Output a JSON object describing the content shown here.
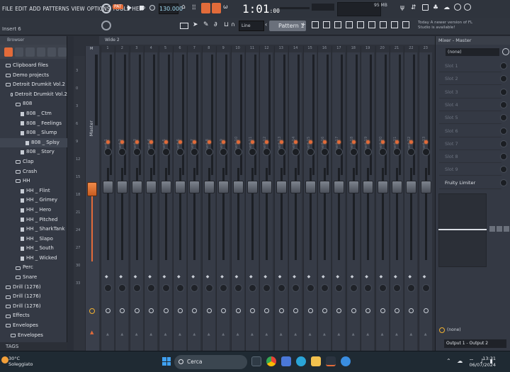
{
  "menu": [
    "FILE",
    "EDIT",
    "ADD",
    "PATTERNS",
    "VIEW",
    "OPTIONS",
    "TOOLS",
    "HELP"
  ],
  "hint": "Insert 6",
  "transport": {
    "pattern_mode": "PAT",
    "tempo": "130.000",
    "time": "1:01",
    "time_sub": ":00"
  },
  "memory": "95 MB",
  "snap": "Line",
  "pattern_name": "Pattern 1",
  "news": "Today  A newer version of FL Studio is available!",
  "browser": {
    "title": "Browser",
    "items": [
      {
        "label": "Clipboard files",
        "indent": 1,
        "kind": "folder"
      },
      {
        "label": "Demo projects",
        "indent": 1,
        "kind": "folder"
      },
      {
        "label": "Detroit Drumkit Vol.2",
        "indent": 1,
        "kind": "folder"
      },
      {
        "label": "Detroit Drumkit Vol.2",
        "indent": 2,
        "kind": "folder"
      },
      {
        "label": "808",
        "indent": 3,
        "kind": "folder"
      },
      {
        "label": "808 _ Ctm",
        "indent": 4,
        "kind": "file"
      },
      {
        "label": "808 _ Feelings",
        "indent": 4,
        "kind": "file"
      },
      {
        "label": "808 _ Slump",
        "indent": 4,
        "kind": "file"
      },
      {
        "label": "808 _ Splsy",
        "indent": 5,
        "kind": "file"
      },
      {
        "label": "808 _ Story",
        "indent": 4,
        "kind": "file"
      },
      {
        "label": "Clap",
        "indent": 3,
        "kind": "folder"
      },
      {
        "label": "Crash",
        "indent": 3,
        "kind": "folder"
      },
      {
        "label": "HH",
        "indent": 3,
        "kind": "folder"
      },
      {
        "label": "HH _ Flint",
        "indent": 4,
        "kind": "file"
      },
      {
        "label": "HH _ Grimey",
        "indent": 4,
        "kind": "file"
      },
      {
        "label": "HH _ Hero",
        "indent": 4,
        "kind": "file"
      },
      {
        "label": "HH _ Pitched",
        "indent": 4,
        "kind": "file"
      },
      {
        "label": "HH _ SharkTank",
        "indent": 4,
        "kind": "file"
      },
      {
        "label": "HH _ Slapo",
        "indent": 4,
        "kind": "file"
      },
      {
        "label": "HH _ South",
        "indent": 4,
        "kind": "file"
      },
      {
        "label": "HH _ Wicked",
        "indent": 4,
        "kind": "file"
      },
      {
        "label": "Perc",
        "indent": 3,
        "kind": "folder"
      },
      {
        "label": "Snare",
        "indent": 3,
        "kind": "folder"
      },
      {
        "label": "Drill (1276)",
        "indent": 1,
        "kind": "folder"
      },
      {
        "label": "Drill (1276)",
        "indent": 1,
        "kind": "folder"
      },
      {
        "label": "Drill (1276)",
        "indent": 1,
        "kind": "folder"
      },
      {
        "label": "Effects",
        "indent": 1,
        "kind": "folder"
      },
      {
        "label": "Envelopes",
        "indent": 1,
        "kind": "folder"
      },
      {
        "label": "Envelopes",
        "indent": 2,
        "kind": "folder"
      }
    ],
    "selected_index": 8,
    "footer": "TAGS"
  },
  "mixer": {
    "view": "Wide 2",
    "master_label": "Master",
    "master_letter": "M",
    "db_scale": [
      "3",
      "0",
      "3",
      "6",
      "9",
      "12",
      "15",
      "18",
      "21",
      "24",
      "27",
      "30",
      "33"
    ],
    "inserts": [
      "Insert 1",
      "Insert 2",
      "Insert 3",
      "Insert 4",
      "Insert 5",
      "Insert 6",
      "Insert 7",
      "Insert 8",
      "Insert 9",
      "Insert 10",
      "Insert 11",
      "Insert 12",
      "Insert 13",
      "Insert 14",
      "Insert 15",
      "Insert 16",
      "Insert 17",
      "Insert 18",
      "Insert 19",
      "Insert 20",
      "Insert 21",
      "Insert 22",
      "Insert 23"
    ]
  },
  "fx_panel": {
    "title": "Mixer - Master",
    "input": "(none)",
    "slots": [
      "Slot 1",
      "Slot 2",
      "Slot 3",
      "Slot 4",
      "Slot 5",
      "Slot 6",
      "Slot 7",
      "Slot 8",
      "Slot 9",
      "Fruity Limiter"
    ],
    "send": "(none)",
    "output": "Output 1 - Output 2"
  },
  "taskbar": {
    "temp": "30°C",
    "weather": "Soleggiato",
    "search": "Cerca",
    "time": "13:31",
    "date": "06/07/2024"
  }
}
